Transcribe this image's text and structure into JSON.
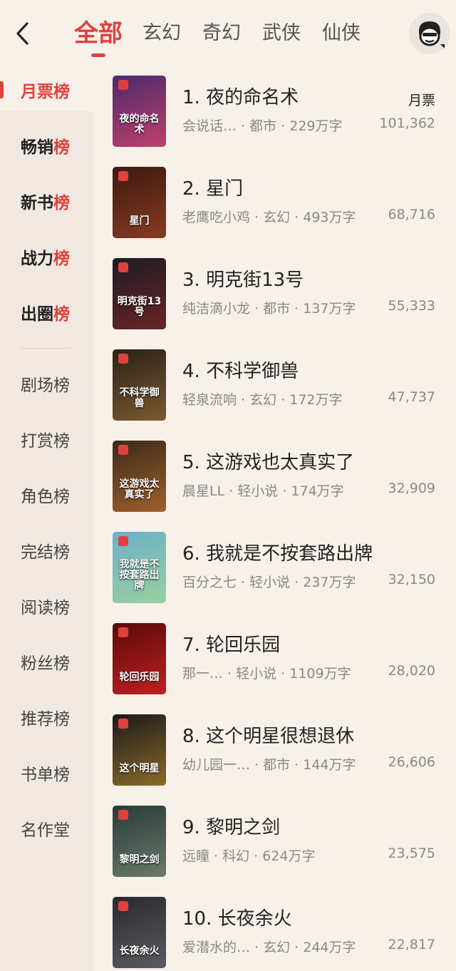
{
  "header": {
    "tabs": [
      "全部",
      "玄幻",
      "奇幻",
      "武侠",
      "仙侠"
    ]
  },
  "sidebar": {
    "primary": [
      {
        "label": "月票榜",
        "active": true
      },
      {
        "label": "畅销榜"
      },
      {
        "label": "新书榜"
      },
      {
        "label": "战力榜"
      },
      {
        "label": "出圈榜"
      }
    ],
    "secondary": [
      "剧场榜",
      "打赏榜",
      "角色榜",
      "完结榜",
      "阅读榜",
      "粉丝榜",
      "推荐榜",
      "书单榜",
      "名作堂"
    ]
  },
  "list": {
    "metric_label": "月票",
    "books": [
      {
        "title": "1. 夜的命名术",
        "meta": "会说话…  · 都市 · 229万字",
        "count": "101,362",
        "cover_text": "夜的命名术",
        "colors": [
          "#4a2a6e",
          "#c0406a"
        ]
      },
      {
        "title": "2. 星门",
        "meta": "老鹰吃小鸡 · 玄幻 · 493万字",
        "count": "68,716",
        "cover_text": "星门",
        "colors": [
          "#3a1a10",
          "#8a3a22"
        ]
      },
      {
        "title": "3. 明克街13号",
        "meta": "纯洁滴小龙 · 都市 · 137万字",
        "count": "55,333",
        "cover_text": "明克街13号",
        "colors": [
          "#1c1c24",
          "#6a2424"
        ]
      },
      {
        "title": "4. 不科学御兽",
        "meta": "轻泉流响 · 玄幻 · 172万字",
        "count": "47,737",
        "cover_text": "不科学御兽",
        "colors": [
          "#2a2218",
          "#7a5a30"
        ]
      },
      {
        "title": "5. 这游戏也太真实了",
        "meta": "晨星LL · 轻小说 · 174万字",
        "count": "32,909",
        "cover_text": "这游戏太真实了",
        "colors": [
          "#3a2a1a",
          "#a0602a"
        ]
      },
      {
        "title": "6. 我就是不按套路出牌",
        "meta": "百分之七 · 轻小说 · 237万字",
        "count": "32,150",
        "cover_text": "我就是不按套路出牌",
        "colors": [
          "#6ab0c8",
          "#9ad0a0"
        ]
      },
      {
        "title": "7. 轮回乐园",
        "meta": "那一…  · 轻小说 · 1109万字",
        "count": "28,020",
        "cover_text": "轮回乐园",
        "colors": [
          "#5a0a0a",
          "#c02020"
        ]
      },
      {
        "title": "8. 这个明星很想退休",
        "meta": "幼儿园一…  · 都市 · 144万字",
        "count": "26,606",
        "cover_text": "这个明星",
        "colors": [
          "#1a1a1a",
          "#8a6a2a"
        ]
      },
      {
        "title": "9. 黎明之剑",
        "meta": "远瞳 · 科幻 · 624万字",
        "count": "23,575",
        "cover_text": "黎明之剑",
        "colors": [
          "#2a3a3a",
          "#6a7a6a"
        ]
      },
      {
        "title": "10. 长夜余火",
        "meta": "爱潜水的…  · 玄幻 · 244万字",
        "count": "22,817",
        "cover_text": "长夜余火",
        "colors": [
          "#2a2a2e",
          "#5a5a60"
        ]
      }
    ]
  },
  "icons": {
    "back": "chevron-left-icon",
    "avatar": "user-avatar-icon"
  },
  "colors": {
    "accent": "#e0413f",
    "background": "#f8f1ea",
    "sidebar": "#f0e8e1"
  }
}
